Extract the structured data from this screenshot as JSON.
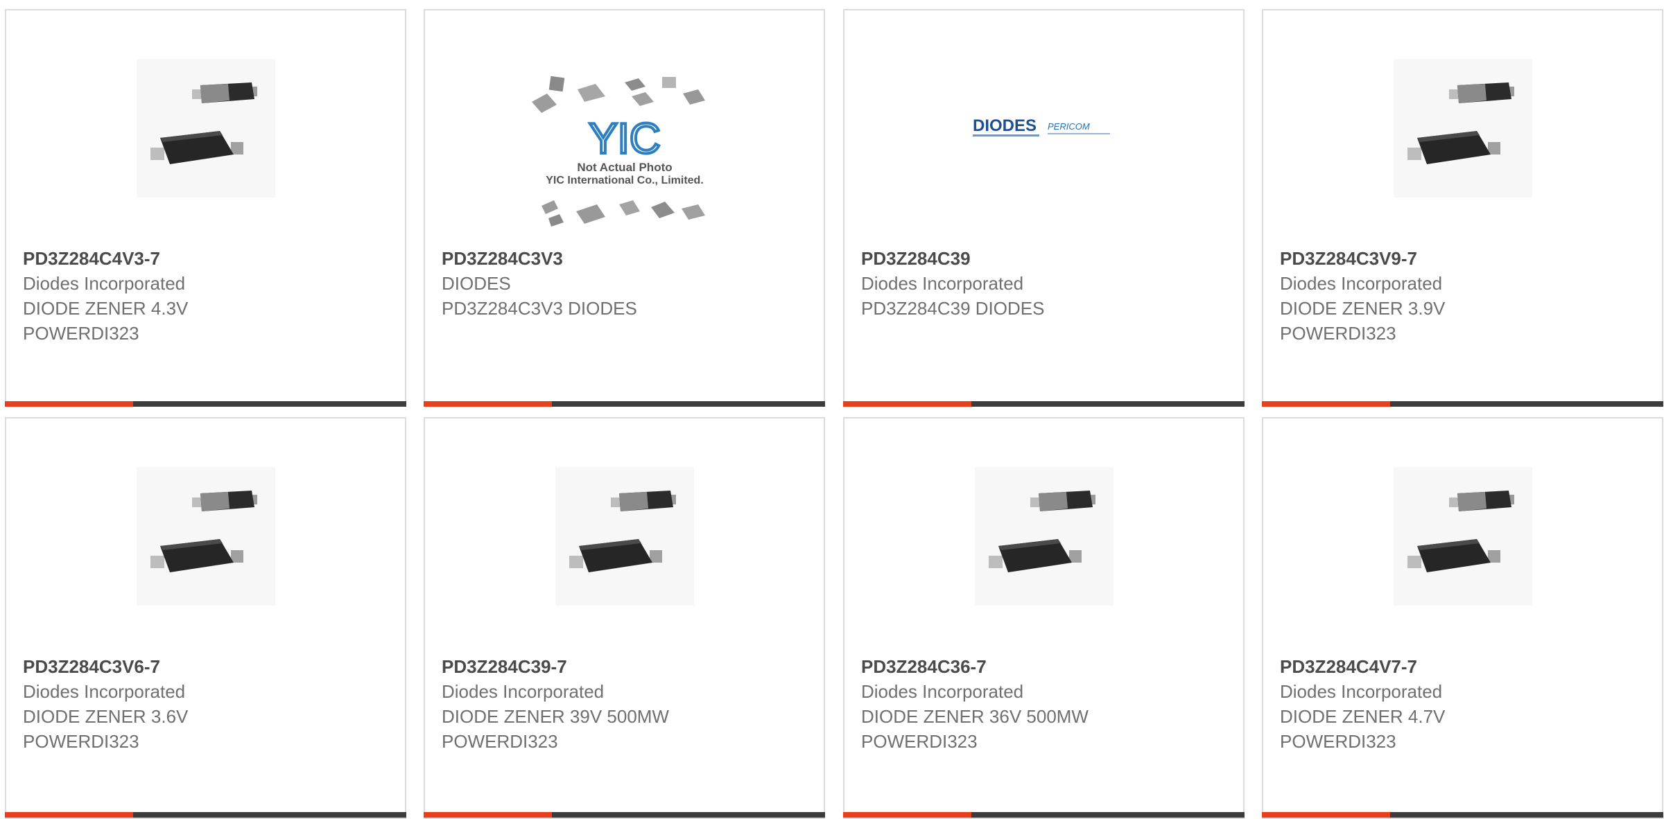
{
  "accent_color": "#e8401c",
  "bar_color": "#3c3c3c",
  "products": [
    {
      "part": "PD3Z284C4V3-7",
      "maker": "Diodes Incorporated",
      "desc": "DIODE ZENER 4.3V\nPOWERDI323",
      "image": "diode-package"
    },
    {
      "part": "PD3Z284C3V3",
      "maker": "DIODES",
      "desc": "PD3Z284C3V3 DIODES",
      "image": "yic-placeholder",
      "image_text": {
        "logo": "YIC",
        "line1": "Not Actual Photo",
        "line2": "YIC International Co., Limited."
      }
    },
    {
      "part": "PD3Z284C39",
      "maker": "Diodes Incorporated",
      "desc": "PD3Z284C39 DIODES",
      "image": "diodes-logo",
      "image_text": {
        "logo": "DIODES",
        "sub": "PERICOM"
      }
    },
    {
      "part": "PD3Z284C3V9-7",
      "maker": "Diodes Incorporated",
      "desc": "DIODE ZENER 3.9V\nPOWERDI323",
      "image": "diode-package"
    },
    {
      "part": "PD3Z284C3V6-7",
      "maker": "Diodes Incorporated",
      "desc": "DIODE ZENER 3.6V\nPOWERDI323",
      "image": "diode-package"
    },
    {
      "part": "PD3Z284C39-7",
      "maker": "Diodes Incorporated",
      "desc": "DIODE ZENER 39V 500MW\nPOWERDI323",
      "image": "diode-package"
    },
    {
      "part": "PD3Z284C36-7",
      "maker": "Diodes Incorporated",
      "desc": "DIODE ZENER 36V 500MW\nPOWERDI323",
      "image": "diode-package"
    },
    {
      "part": "PD3Z284C4V7-7",
      "maker": "Diodes Incorporated",
      "desc": "DIODE ZENER 4.7V\nPOWERDI323",
      "image": "diode-package"
    }
  ]
}
